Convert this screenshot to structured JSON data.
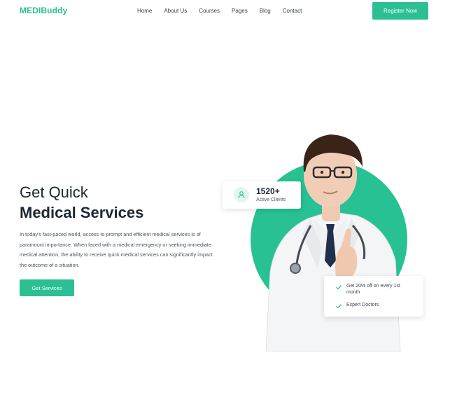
{
  "header": {
    "logo": "MEDIBuddy",
    "nav": [
      "Home",
      "About Us",
      "Courses",
      "Pages",
      "Blog",
      "Contact"
    ],
    "register_label": "Register Now"
  },
  "hero": {
    "title_line1": "Get Quick",
    "title_line2": "Medical Services",
    "description": "In today's fast-paced world, access to prompt and efficient medical services is of paramount importance. When faced with a medical emergency or seeking immediate medical attention, the ability to receive quick medical services can significantly impact the outcome of a situation.",
    "cta_label": "Get Services"
  },
  "stats_card": {
    "icon": "user-icon",
    "value": "1520+",
    "label": "Active Clients"
  },
  "offer_card": {
    "items": [
      "Get 20% off on every 1st month",
      "Expert Doctors"
    ]
  },
  "colors": {
    "accent": "#2bbf93",
    "text_dark": "#1d2733"
  }
}
